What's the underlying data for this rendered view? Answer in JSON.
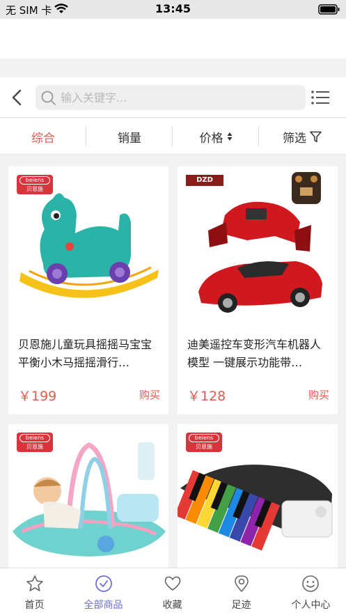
{
  "status_bar": {
    "carrier": "无 SIM 卡",
    "time": "13:45"
  },
  "search": {
    "placeholder": "输入关键字..."
  },
  "filters": [
    {
      "label": "综合"
    },
    {
      "label": "销量"
    },
    {
      "label": "价格"
    },
    {
      "label": "筛选"
    }
  ],
  "products": [
    {
      "title": "贝恩施儿童玩具摇摇马宝宝平衡小木马摇摇滑行…",
      "price": "￥199",
      "buy_label": "购买",
      "badge_en": "beiens",
      "badge_cn": "贝恩施"
    },
    {
      "title": "迪美遥控车变形汽车机器人模型 一键展示功能带…",
      "price": "￥128",
      "buy_label": "购买",
      "badge_en": "DZD"
    },
    {
      "badge_en": "beiens",
      "badge_cn": "贝恩施"
    },
    {
      "badge_en": "beiens",
      "badge_cn": "贝恩施"
    }
  ],
  "tabbar": [
    {
      "label": "首页",
      "icon": "star-icon"
    },
    {
      "label": "全部商品",
      "icon": "check-circle-icon"
    },
    {
      "label": "收藏",
      "icon": "heart-icon"
    },
    {
      "label": "足迹",
      "icon": "location-pin-icon"
    },
    {
      "label": "个人中心",
      "icon": "smiley-icon"
    }
  ],
  "colors": {
    "accent": "#e05a4e",
    "active_tab": "#6b6fd6"
  }
}
